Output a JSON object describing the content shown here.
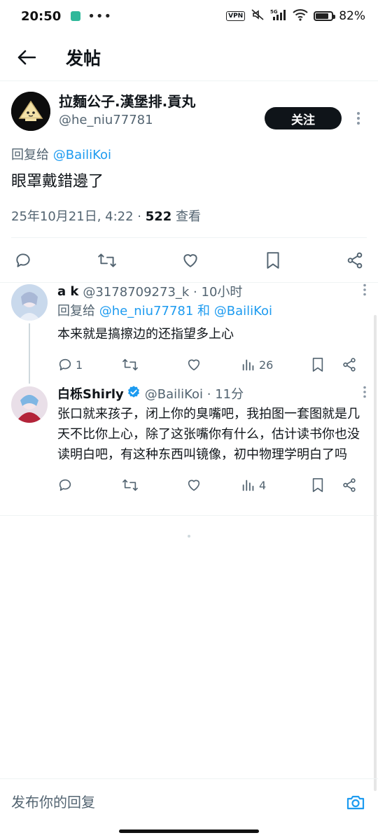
{
  "status_bar": {
    "time": "20:50",
    "dots": "•••",
    "vpn": "VPN",
    "network": "5G",
    "battery": "82%",
    "battery_level": 0.82
  },
  "header": {
    "back_icon": "arrow-left-icon",
    "title": "发帖"
  },
  "post": {
    "author_name": "拉麵公子.漢堡排.貢丸",
    "author_handle": "@he_niu77781",
    "follow_label": "关注",
    "reply_to_prefix": "回复给",
    "reply_to_mention": "@BailiKoi",
    "text": "眼罩戴錯邊了",
    "timestamp": "25年10月21日, 4:22 · ",
    "views_count": "522",
    "views_label": " 查看"
  },
  "replies": [
    {
      "name": "a k",
      "handle": "@3178709273_k · 10小时",
      "reply_to_prefix": "回复给 ",
      "reply_to_mentions": "@he_niu77781 和 @BailiKoi",
      "text": "本来就是搞擦边的还指望多上心",
      "reply_count": "1",
      "views": "26"
    },
    {
      "name": "白栎Shirly",
      "handle": "@BailiKoi · 11分",
      "text": "张口就来孩子，闭上你的臭嘴吧，我拍图一套图就是几天不比你上心，除了这张嘴你有什么，估计读书你也没读明白吧，有这种东西叫镜像，初中物理学明白了吗",
      "views": "4"
    }
  ],
  "composer": {
    "placeholder": "发布你的回复",
    "camera_icon": "camera-icon"
  },
  "colors": {
    "accent": "#1d9bf0",
    "text": "#0f1419",
    "secondary": "#536471"
  }
}
